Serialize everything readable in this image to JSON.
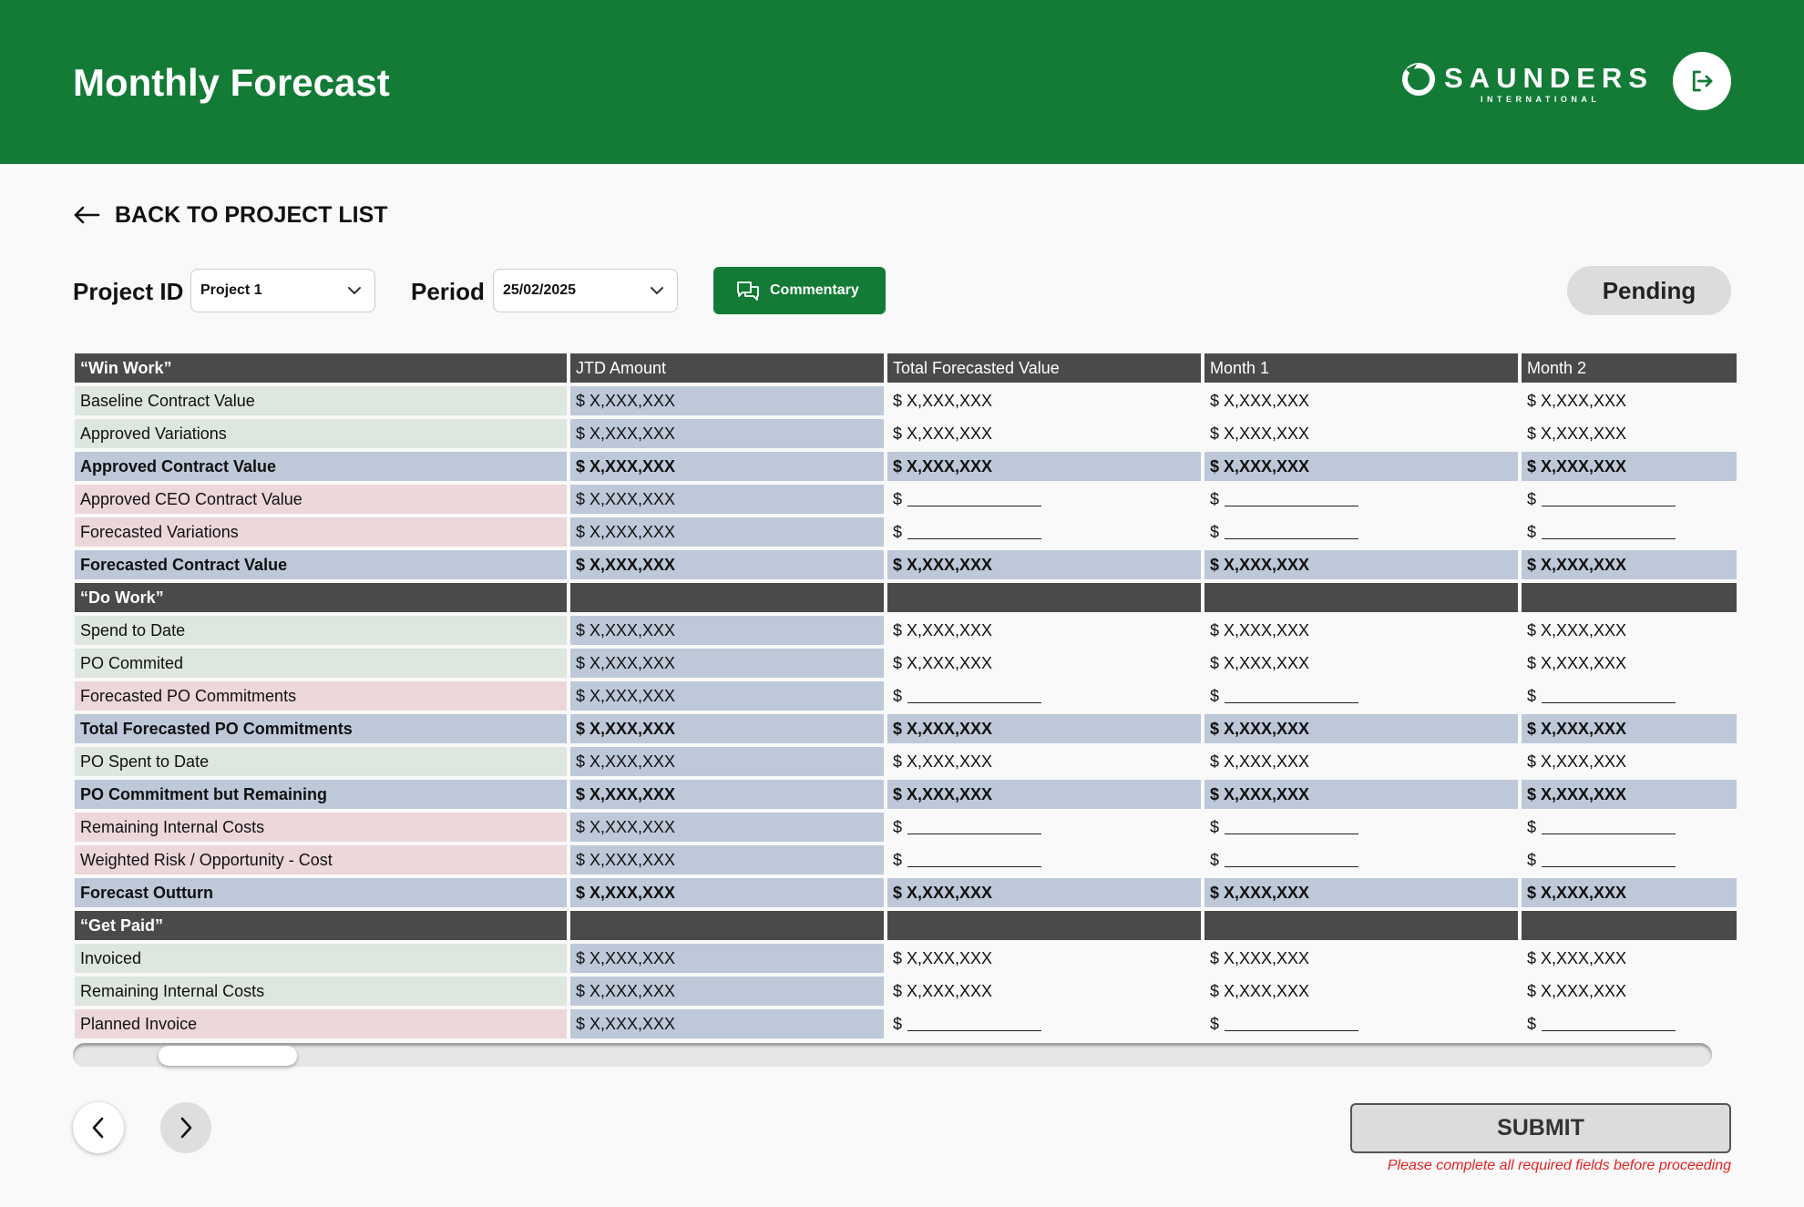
{
  "header": {
    "title": "Monthly Forecast",
    "logo_text": "SAUNDERS",
    "logo_subtext": "INTERNATIONAL",
    "brand_color": "#137b36"
  },
  "back_link": {
    "label": "BACK TO PROJECT LIST"
  },
  "filters": {
    "project_label": "Project ID",
    "project_value": "Project 1",
    "period_label": "Period",
    "period_value": "25/02/2025"
  },
  "commentary_button": {
    "label": "Commentary"
  },
  "status": {
    "label": "Pending"
  },
  "table": {
    "columns": [
      "JTD Amount",
      "Total Forecasted Value",
      "Month 1",
      "Month 2"
    ],
    "rows": [
      {
        "type": "section",
        "label": "“Win Work”"
      },
      {
        "type": "green",
        "label": "Baseline Contract Value",
        "values": [
          "$ X,XXX,XXX",
          "$ X,XXX,XXX",
          "$ X,XXX,XXX",
          "$ X,XXX,XXX"
        ]
      },
      {
        "type": "green",
        "label": "Approved Variations",
        "values": [
          "$ X,XXX,XXX",
          "$ X,XXX,XXX",
          "$ X,XXX,XXX",
          "$ X,XXX,XXX"
        ]
      },
      {
        "type": "total",
        "label": "Approved Contract Value",
        "values": [
          "$ X,XXX,XXX",
          "$ X,XXX,XXX",
          "$ X,XXX,XXX",
          "$ X,XXX,XXX"
        ]
      },
      {
        "type": "input",
        "label": "Approved CEO Contract Value",
        "values": [
          "$ X,XXX,XXX",
          "$",
          "$",
          "$"
        ]
      },
      {
        "type": "input",
        "label": "Forecasted Variations",
        "values": [
          "$ X,XXX,XXX",
          "$",
          "$",
          "$"
        ]
      },
      {
        "type": "total",
        "label": "Forecasted Contract Value",
        "values": [
          "$ X,XXX,XXX",
          "$ X,XXX,XXX",
          "$ X,XXX,XXX",
          "$ X,XXX,XXX"
        ]
      },
      {
        "type": "section",
        "label": "“Do Work”"
      },
      {
        "type": "green",
        "label": "Spend to Date",
        "values": [
          "$ X,XXX,XXX",
          "$ X,XXX,XXX",
          "$ X,XXX,XXX",
          "$ X,XXX,XXX"
        ]
      },
      {
        "type": "green",
        "label": "PO Commited",
        "values": [
          "$ X,XXX,XXX",
          "$ X,XXX,XXX",
          "$ X,XXX,XXX",
          "$ X,XXX,XXX"
        ]
      },
      {
        "type": "input",
        "label": "Forecasted PO Commitments",
        "values": [
          "$ X,XXX,XXX",
          "$",
          "$",
          "$"
        ]
      },
      {
        "type": "total",
        "label": "Total Forecasted PO Commitments",
        "values": [
          "$ X,XXX,XXX",
          "$ X,XXX,XXX",
          "$ X,XXX,XXX",
          "$ X,XXX,XXX"
        ]
      },
      {
        "type": "green",
        "label": "PO Spent to Date",
        "values": [
          "$ X,XXX,XXX",
          "$ X,XXX,XXX",
          "$ X,XXX,XXX",
          "$ X,XXX,XXX"
        ]
      },
      {
        "type": "total",
        "label": "PO Commitment but Remaining",
        "values": [
          "$ X,XXX,XXX",
          "$ X,XXX,XXX",
          "$ X,XXX,XXX",
          "$ X,XXX,XXX"
        ]
      },
      {
        "type": "input",
        "label": "Remaining Internal Costs",
        "values": [
          "$ X,XXX,XXX",
          "$",
          "$",
          "$"
        ]
      },
      {
        "type": "input",
        "label": "Weighted Risk / Opportunity - Cost",
        "values": [
          "$ X,XXX,XXX",
          "$",
          "$",
          "$"
        ]
      },
      {
        "type": "total",
        "label": "Forecast Outturn",
        "values": [
          "$ X,XXX,XXX",
          "$ X,XXX,XXX",
          "$ X,XXX,XXX",
          "$ X,XXX,XXX"
        ]
      },
      {
        "type": "section",
        "label": "“Get Paid”"
      },
      {
        "type": "green",
        "label": "Invoiced",
        "values": [
          "$ X,XXX,XXX",
          "$ X,XXX,XXX",
          "$ X,XXX,XXX",
          "$ X,XXX,XXX"
        ]
      },
      {
        "type": "green",
        "label": "Remaining Internal Costs",
        "values": [
          "$ X,XXX,XXX",
          "$ X,XXX,XXX",
          "$ X,XXX,XXX",
          "$ X,XXX,XXX"
        ]
      },
      {
        "type": "input",
        "label": "Planned Invoice",
        "values": [
          "$ X,XXX,XXX",
          "$",
          "$",
          "$"
        ]
      }
    ]
  },
  "scroll": {
    "position": 0.06
  },
  "footer": {
    "submit_label": "SUBMIT",
    "warning": "Please complete all required fields before proceeding"
  },
  "icons": [
    "logout-icon",
    "arrow-left-icon",
    "chevron-down-icon",
    "chat-bubbles-icon",
    "chevron-left-icon",
    "chevron-right-icon"
  ]
}
